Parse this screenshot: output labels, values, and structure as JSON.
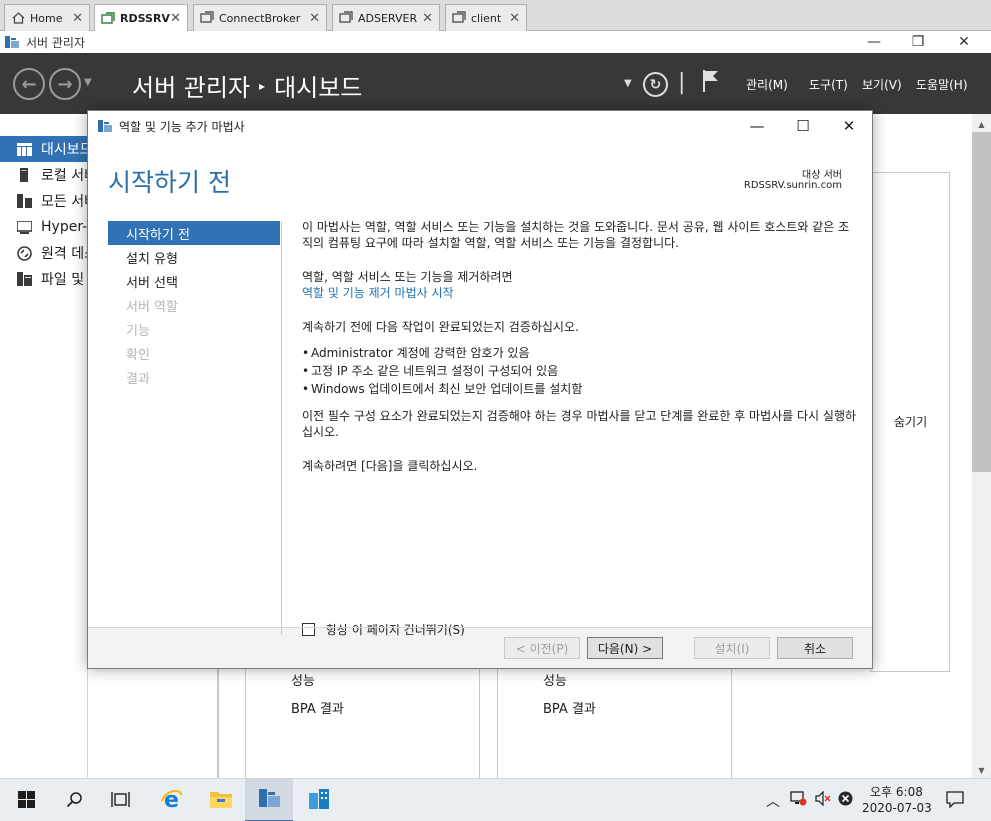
{
  "browser_tabs": [
    {
      "label": "Home"
    },
    {
      "label": "RDSSRV"
    },
    {
      "label": "ConnectBroker"
    },
    {
      "label": "ADSERVER"
    },
    {
      "label": "client"
    }
  ],
  "window": {
    "title": "서버 관리자"
  },
  "header": {
    "breadcrumb_root": "서버 관리자",
    "breadcrumb_sep": "▸",
    "breadcrumb_page": "대시보드",
    "menus": [
      "관리(M)",
      "도구(T)",
      "보기(V)",
      "도움말(H)"
    ]
  },
  "sidebar": {
    "items": [
      {
        "label": "대시보드",
        "icon": "dashboard-icon"
      },
      {
        "label": "로컬 서버",
        "icon": "server-icon"
      },
      {
        "label": "모든 서버",
        "icon": "servers-icon"
      },
      {
        "label": "Hyper-V",
        "icon": "hyperv-icon"
      },
      {
        "label": "원격 데스크톱 서비스",
        "icon": "remote-desktop-icon"
      },
      {
        "label": "파일 및 저장소 서비스",
        "icon": "file-storage-icon"
      }
    ]
  },
  "background": {
    "hide_label": "숨기기",
    "tile1": {
      "line1": "성능",
      "line2": "BPA 결과"
    },
    "tile2": {
      "line1": "성능",
      "line2": "BPA 결과"
    }
  },
  "dialog": {
    "title": "역할 및 기능 추가 마법사",
    "heading": "시작하기 전",
    "destination_label": "대상 서버",
    "destination_value": "RDSSRV.sunrin.com",
    "steps": [
      {
        "label": "시작하기 전",
        "state": "active"
      },
      {
        "label": "설치 유형",
        "state": "enabled"
      },
      {
        "label": "서버 선택",
        "state": "enabled"
      },
      {
        "label": "서버 역할",
        "state": "disabled"
      },
      {
        "label": "기능",
        "state": "disabled"
      },
      {
        "label": "확인",
        "state": "disabled"
      },
      {
        "label": "결과",
        "state": "disabled"
      }
    ],
    "intro": "이 마법사는 역할, 역할 서비스 또는 기능을 설치하는 것을 도와줍니다. 문서 공유, 웹 사이트 호스트와 같은 조직의 컴퓨팅 요구에 따라 설치할 역할, 역할 서비스 또는 기능을 결정합니다.",
    "remove_text": "역할, 역할 서비스 또는 기능을 제거하려면",
    "remove_link": "역할 및 기능 제거 마법사 시작",
    "verify_text": "계속하기 전에 다음 작업이 완료되었는지 검증하십시오.",
    "bullets": [
      "Administrator 계정에 강력한 암호가 있음",
      "고정 IP 주소 같은 네트워크 설정이 구성되어 있음",
      "Windows 업데이트에서 최신 보안 업데이트를 설치함"
    ],
    "prereq_text": "이전 필수 구성 요소가 완료되었는지 검증해야 하는 경우 마법사를 닫고 단계를 완료한 후 마법사를 다시 실행하십시오.",
    "continue_text": "계속하려면 [다음]을 클릭하십시오.",
    "skip_label": "항상 이 페이지 건너뛰기(S)",
    "buttons": {
      "prev": "< 이전(P)",
      "next": "다음(N) >",
      "install": "설치(I)",
      "cancel": "취소"
    }
  },
  "taskbar": {
    "time": "오후 6:08",
    "date": "2020-07-03"
  },
  "colors": {
    "accent": "#3072b3",
    "heading": "#2d6fa8",
    "header_bg": "#383838",
    "link": "#1f73b5"
  }
}
